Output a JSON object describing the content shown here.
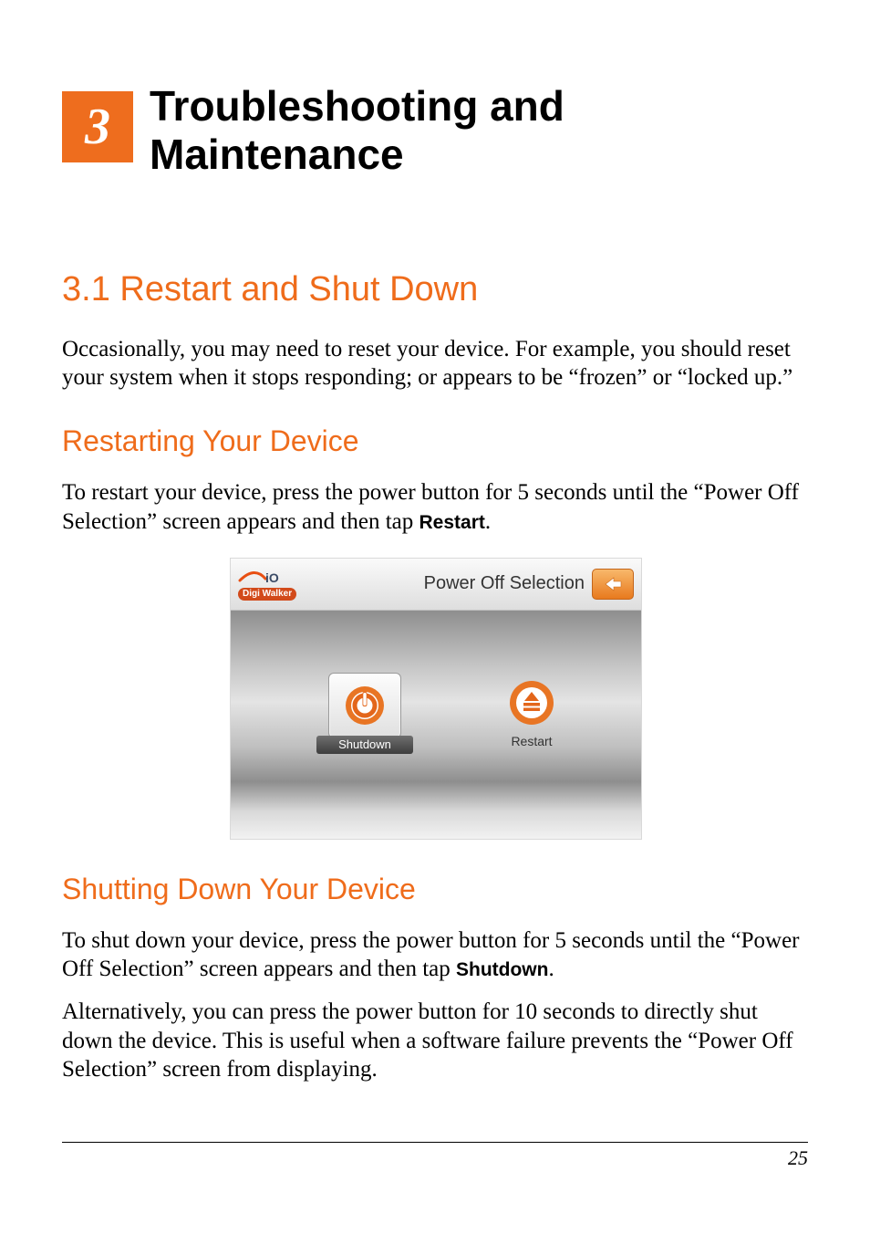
{
  "chapter": {
    "number": "3",
    "title": "Troubleshooting and Maintenance"
  },
  "section_3_1": {
    "heading": "3.1   Restart and Shut Down",
    "intro": "Occasionally, you may need to reset your device. For example, you should reset your system when it stops responding; or appears to be “frozen” or “locked up.”"
  },
  "restart_section": {
    "heading": "Restarting Your Device",
    "para_prefix": "To restart your device, press the power button for 5 seconds until the “Power Off Selection” screen appears and then tap ",
    "para_bold": "Restart",
    "para_suffix": "."
  },
  "shutdown_section": {
    "heading": "Shutting Down Your Device",
    "p1_prefix": "To shut down your device, press the power button for 5 seconds until the “Power Off Selection” screen appears and then tap ",
    "p1_bold": "Shutdown",
    "p1_suffix": ".",
    "p2": "Alternatively, you can press the power button for 10 seconds to directly shut down the device. This is useful when a software failure prevents the “Power Off Selection” screen from displaying."
  },
  "device_screenshot": {
    "logo_text": "mio",
    "logo_badge": "Digi Walker",
    "header_title": "Power Off Selection",
    "shutdown_label": "Shutdown",
    "restart_label": "Restart"
  },
  "colors": {
    "accent": "#ef6c1b"
  },
  "page_number": "25"
}
